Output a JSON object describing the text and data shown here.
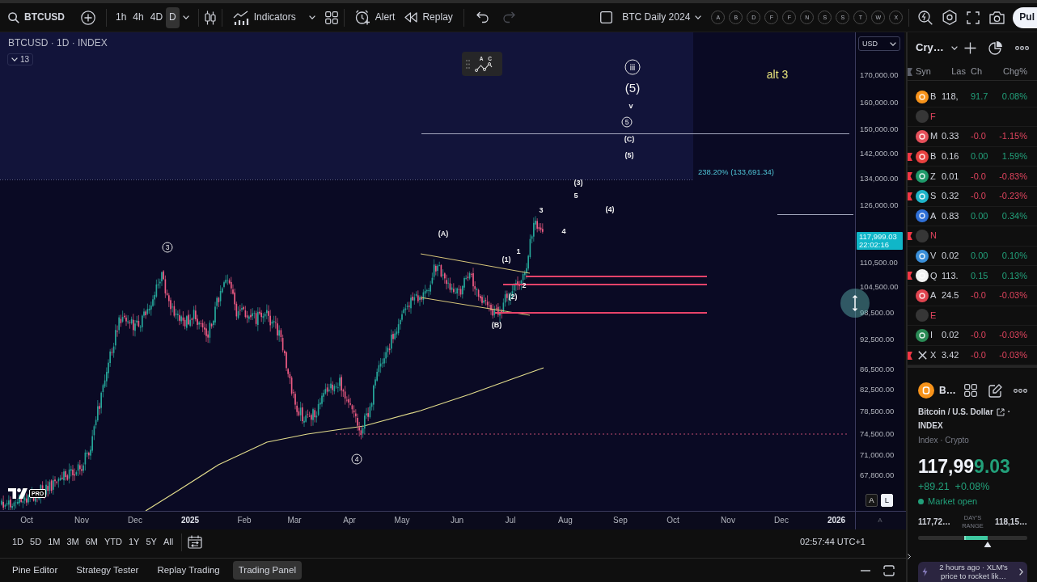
{
  "toolbar": {
    "symbol": "BTCUSD",
    "intervals": [
      {
        "label": "1h",
        "selected": false
      },
      {
        "label": "4h",
        "selected": false
      },
      {
        "label": "4D",
        "selected": false
      },
      {
        "label": "D",
        "selected": true
      }
    ],
    "indicators": "Indicators",
    "alert": "Alert",
    "replay": "Replay",
    "history": [
      {
        "kind": "undo",
        "disabled": false
      },
      {
        "kind": "redo",
        "disabled": true
      }
    ],
    "layout_name": "BTC Daily 2024",
    "quick_symbols": [
      "A",
      "B",
      "D",
      "F",
      "F",
      "N",
      "S",
      "S",
      "T",
      "W",
      "X"
    ],
    "publish": "Pul"
  },
  "chart": {
    "legend": "BTCUSD · 1D · INDEX",
    "indicator_count": "13",
    "wave_tool_letters": [
      "A",
      "C"
    ],
    "note": "alt 3",
    "fib_label": "238.20% (133,691.34)",
    "wave_labels": [
      {
        "text": "iii",
        "kind": "circled"
      },
      {
        "text": "(5)",
        "kind": "large"
      },
      {
        "text": "v",
        "kind": "plain"
      },
      {
        "text": "5",
        "kind": "circled"
      },
      {
        "text": "(C)",
        "kind": "plain"
      },
      {
        "text": "(5)",
        "kind": "plain"
      },
      {
        "text": "(3)",
        "kind": "plain"
      },
      {
        "text": "5",
        "kind": "plain"
      },
      {
        "text": "3",
        "kind": "plain"
      },
      {
        "text": "(4)",
        "kind": "plain"
      },
      {
        "text": "4",
        "kind": "plain"
      },
      {
        "text": "(A)",
        "kind": "plain"
      },
      {
        "text": "3",
        "kind": "circled"
      },
      {
        "text": "1",
        "kind": "plain"
      },
      {
        "text": "(1)",
        "kind": "plain"
      },
      {
        "text": "2",
        "kind": "plain"
      },
      {
        "text": "(2)",
        "kind": "plain"
      },
      {
        "text": "(B)",
        "kind": "plain"
      },
      {
        "text": "4",
        "kind": "circled"
      }
    ],
    "logo_badge": "PRO",
    "scale_buttons": [
      {
        "label": "A",
        "selected": false
      },
      {
        "label": "L",
        "selected": true
      }
    ],
    "currency": "USD",
    "price_ticks": [
      "170,000.00",
      "160,000.00",
      "150,000.00",
      "142,000.00",
      "134,000.00",
      "126,000.00",
      "110,500.00",
      "104,500.00",
      "98,500.00",
      "92,500.00",
      "86,500.00",
      "82,500.00",
      "78,500.00",
      "74,500.00",
      "71,000.00",
      "67,800.00"
    ],
    "last_price": "117,999.03",
    "countdown": "22:02:16"
  },
  "time_axis": {
    "ticks": [
      {
        "label": "Oct",
        "kind": "month"
      },
      {
        "label": "Nov",
        "kind": "month"
      },
      {
        "label": "Dec",
        "kind": "month"
      },
      {
        "label": "2025",
        "kind": "year"
      },
      {
        "label": "Feb",
        "kind": "month"
      },
      {
        "label": "Mar",
        "kind": "month"
      },
      {
        "label": "Apr",
        "kind": "month"
      },
      {
        "label": "May",
        "kind": "month"
      },
      {
        "label": "Jun",
        "kind": "month"
      },
      {
        "label": "Jul",
        "kind": "month"
      },
      {
        "label": "Aug",
        "kind": "month"
      },
      {
        "label": "Sep",
        "kind": "month"
      },
      {
        "label": "Oct",
        "kind": "month"
      },
      {
        "label": "Nov",
        "kind": "month"
      },
      {
        "label": "Dec",
        "kind": "month"
      },
      {
        "label": "2026",
        "kind": "year"
      }
    ],
    "auto_button": "A"
  },
  "range_bar": {
    "ranges": [
      "1D",
      "5D",
      "1M",
      "3M",
      "6M",
      "YTD",
      "1Y",
      "5Y",
      "All"
    ],
    "clock": "02:57:44 UTC+1"
  },
  "bottom_tabs": [
    {
      "label": "Pine Editor",
      "selected": false
    },
    {
      "label": "Strategy Tester",
      "selected": false
    },
    {
      "label": "Replay Trading",
      "selected": false
    },
    {
      "label": "Trading Panel",
      "selected": true
    }
  ],
  "watchlist": {
    "title": "Cry…",
    "columns": [
      "Syn",
      "Las",
      "Ch",
      "Chg%"
    ],
    "rows": [
      {
        "symbol": "B",
        "kind": "gain",
        "logo": {
          "kind": "disc",
          "color": "#f7931a"
        },
        "flagged": false,
        "last": "118,",
        "change": "91.7",
        "change_percent": "0.08%"
      },
      {
        "symbol": "F",
        "kind": "unavailable",
        "logo": {
          "kind": "disc",
          "color": "#363636"
        },
        "flagged": false
      },
      {
        "symbol": "M",
        "kind": "loss",
        "logo": {
          "kind": "disc",
          "color": "#e5505a"
        },
        "flagged": false,
        "last": "0.33",
        "change": "-0.0",
        "change_percent": "-1.15%"
      },
      {
        "symbol": "B",
        "kind": "gain",
        "logo": {
          "kind": "disc",
          "color": "#e8413f"
        },
        "flagged": true,
        "last": "0.16",
        "change": "0.00",
        "change_percent": "1.59%"
      },
      {
        "symbol": "Z",
        "kind": "loss",
        "logo": {
          "kind": "disc",
          "color": "#1f9a6a"
        },
        "flagged": true,
        "last": "0.01",
        "change": "-0.0",
        "change_percent": "-0.83%"
      },
      {
        "symbol": "S",
        "kind": "loss",
        "logo": {
          "kind": "disc",
          "color": "#1fb5c9"
        },
        "flagged": true,
        "last": "0.32",
        "change": "-0.0",
        "change_percent": "-0.23%"
      },
      {
        "symbol": "A",
        "kind": "gain",
        "logo": {
          "kind": "disc",
          "color": "#2f6fd6"
        },
        "flagged": false,
        "last": "0.83",
        "change": "0.00",
        "change_percent": "0.34%"
      },
      {
        "symbol": "N",
        "kind": "unavailable",
        "logo": {
          "kind": "disc",
          "color": "#363636"
        },
        "flagged": true
      },
      {
        "symbol": "V",
        "kind": "gain",
        "logo": {
          "kind": "disc",
          "color": "#3a8fd9"
        },
        "flagged": false,
        "last": "0.02",
        "change": "0.00",
        "change_percent": "0.10%"
      },
      {
        "symbol": "Q",
        "kind": "gain",
        "logo": {
          "kind": "disc",
          "color": "#f2f2f2"
        },
        "flagged": true,
        "last": "113.",
        "change": "0.15",
        "change_percent": "0.13%"
      },
      {
        "symbol": "A",
        "kind": "loss",
        "logo": {
          "kind": "disc",
          "color": "#e0444f"
        },
        "flagged": false,
        "last": "24.5",
        "change": "-0.0",
        "change_percent": "-0.03%"
      },
      {
        "symbol": "E",
        "kind": "unavailable",
        "logo": {
          "kind": "disc",
          "color": "#363636"
        },
        "flagged": false
      },
      {
        "symbol": "I",
        "kind": "loss",
        "logo": {
          "kind": "disc",
          "color": "#2a8a55"
        },
        "flagged": false,
        "last": "0.02",
        "change": "-0.0",
        "change_percent": "-0.03%"
      },
      {
        "symbol": "X",
        "kind": "loss",
        "logo": {
          "kind": "cross",
          "color": "#d1d4dc"
        },
        "flagged": true,
        "last": "3.42",
        "change": "-0.0",
        "change_percent": "-0.03%"
      }
    ]
  },
  "details": {
    "symbol": "B…",
    "name": "Bitcoin / U.S. Dollar",
    "name_separator": "·",
    "exchange": "INDEX",
    "category": "Index · Crypto",
    "price": "117,99",
    "price_changed_digits": "9.03",
    "change": "+89.21",
    "change_percent": "+0.08%",
    "market_status": "Market open",
    "range_low": "117,72…",
    "range_title": "DAY'S RANGE",
    "range_high": "118,15…",
    "day_range": {
      "open": {
        "level": 0.43
      },
      "current": {
        "level": 0.64
      }
    },
    "news": {
      "time": "2 hours ago",
      "separator": "·",
      "headline": "XLM's price to rocket lik…"
    }
  }
}
